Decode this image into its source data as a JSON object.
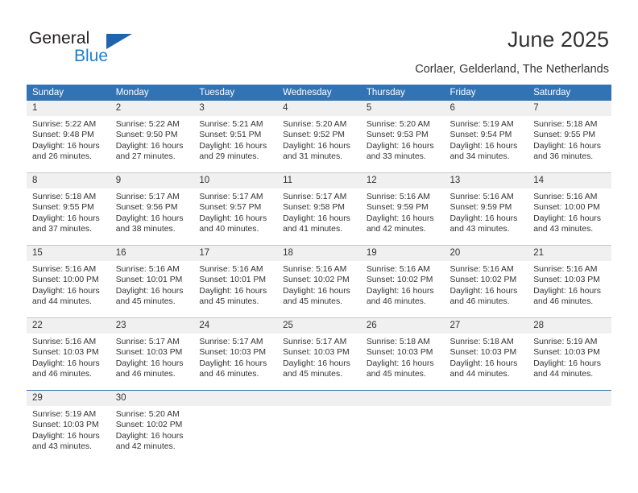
{
  "brand": {
    "name_part1": "General",
    "name_part2": "Blue",
    "triangle_color": "#1f64ad",
    "blue_color": "#1a7fd4"
  },
  "header": {
    "title": "June 2025",
    "subtitle": "Corlaer, Gelderland, The Netherlands"
  },
  "theme": {
    "header_bg": "#3273b5",
    "daynum_bg": "#f0f0f0",
    "text": "#333333",
    "row_divider": "#c8c8c8",
    "accent_divider": "#2f6eb0"
  },
  "calendar": {
    "weekdays": [
      "Sunday",
      "Monday",
      "Tuesday",
      "Wednesday",
      "Thursday",
      "Friday",
      "Saturday"
    ],
    "weeks": [
      [
        {
          "day": "1",
          "sunrise": "Sunrise: 5:22 AM",
          "sunset": "Sunset: 9:48 PM",
          "daylight1": "Daylight: 16 hours",
          "daylight2": "and 26 minutes."
        },
        {
          "day": "2",
          "sunrise": "Sunrise: 5:22 AM",
          "sunset": "Sunset: 9:50 PM",
          "daylight1": "Daylight: 16 hours",
          "daylight2": "and 27 minutes."
        },
        {
          "day": "3",
          "sunrise": "Sunrise: 5:21 AM",
          "sunset": "Sunset: 9:51 PM",
          "daylight1": "Daylight: 16 hours",
          "daylight2": "and 29 minutes."
        },
        {
          "day": "4",
          "sunrise": "Sunrise: 5:20 AM",
          "sunset": "Sunset: 9:52 PM",
          "daylight1": "Daylight: 16 hours",
          "daylight2": "and 31 minutes."
        },
        {
          "day": "5",
          "sunrise": "Sunrise: 5:20 AM",
          "sunset": "Sunset: 9:53 PM",
          "daylight1": "Daylight: 16 hours",
          "daylight2": "and 33 minutes."
        },
        {
          "day": "6",
          "sunrise": "Sunrise: 5:19 AM",
          "sunset": "Sunset: 9:54 PM",
          "daylight1": "Daylight: 16 hours",
          "daylight2": "and 34 minutes."
        },
        {
          "day": "7",
          "sunrise": "Sunrise: 5:18 AM",
          "sunset": "Sunset: 9:55 PM",
          "daylight1": "Daylight: 16 hours",
          "daylight2": "and 36 minutes."
        }
      ],
      [
        {
          "day": "8",
          "sunrise": "Sunrise: 5:18 AM",
          "sunset": "Sunset: 9:55 PM",
          "daylight1": "Daylight: 16 hours",
          "daylight2": "and 37 minutes."
        },
        {
          "day": "9",
          "sunrise": "Sunrise: 5:17 AM",
          "sunset": "Sunset: 9:56 PM",
          "daylight1": "Daylight: 16 hours",
          "daylight2": "and 38 minutes."
        },
        {
          "day": "10",
          "sunrise": "Sunrise: 5:17 AM",
          "sunset": "Sunset: 9:57 PM",
          "daylight1": "Daylight: 16 hours",
          "daylight2": "and 40 minutes."
        },
        {
          "day": "11",
          "sunrise": "Sunrise: 5:17 AM",
          "sunset": "Sunset: 9:58 PM",
          "daylight1": "Daylight: 16 hours",
          "daylight2": "and 41 minutes."
        },
        {
          "day": "12",
          "sunrise": "Sunrise: 5:16 AM",
          "sunset": "Sunset: 9:59 PM",
          "daylight1": "Daylight: 16 hours",
          "daylight2": "and 42 minutes."
        },
        {
          "day": "13",
          "sunrise": "Sunrise: 5:16 AM",
          "sunset": "Sunset: 9:59 PM",
          "daylight1": "Daylight: 16 hours",
          "daylight2": "and 43 minutes."
        },
        {
          "day": "14",
          "sunrise": "Sunrise: 5:16 AM",
          "sunset": "Sunset: 10:00 PM",
          "daylight1": "Daylight: 16 hours",
          "daylight2": "and 43 minutes."
        }
      ],
      [
        {
          "day": "15",
          "sunrise": "Sunrise: 5:16 AM",
          "sunset": "Sunset: 10:00 PM",
          "daylight1": "Daylight: 16 hours",
          "daylight2": "and 44 minutes."
        },
        {
          "day": "16",
          "sunrise": "Sunrise: 5:16 AM",
          "sunset": "Sunset: 10:01 PM",
          "daylight1": "Daylight: 16 hours",
          "daylight2": "and 45 minutes."
        },
        {
          "day": "17",
          "sunrise": "Sunrise: 5:16 AM",
          "sunset": "Sunset: 10:01 PM",
          "daylight1": "Daylight: 16 hours",
          "daylight2": "and 45 minutes."
        },
        {
          "day": "18",
          "sunrise": "Sunrise: 5:16 AM",
          "sunset": "Sunset: 10:02 PM",
          "daylight1": "Daylight: 16 hours",
          "daylight2": "and 45 minutes."
        },
        {
          "day": "19",
          "sunrise": "Sunrise: 5:16 AM",
          "sunset": "Sunset: 10:02 PM",
          "daylight1": "Daylight: 16 hours",
          "daylight2": "and 46 minutes."
        },
        {
          "day": "20",
          "sunrise": "Sunrise: 5:16 AM",
          "sunset": "Sunset: 10:02 PM",
          "daylight1": "Daylight: 16 hours",
          "daylight2": "and 46 minutes."
        },
        {
          "day": "21",
          "sunrise": "Sunrise: 5:16 AM",
          "sunset": "Sunset: 10:03 PM",
          "daylight1": "Daylight: 16 hours",
          "daylight2": "and 46 minutes."
        }
      ],
      [
        {
          "day": "22",
          "sunrise": "Sunrise: 5:16 AM",
          "sunset": "Sunset: 10:03 PM",
          "daylight1": "Daylight: 16 hours",
          "daylight2": "and 46 minutes."
        },
        {
          "day": "23",
          "sunrise": "Sunrise: 5:17 AM",
          "sunset": "Sunset: 10:03 PM",
          "daylight1": "Daylight: 16 hours",
          "daylight2": "and 46 minutes."
        },
        {
          "day": "24",
          "sunrise": "Sunrise: 5:17 AM",
          "sunset": "Sunset: 10:03 PM",
          "daylight1": "Daylight: 16 hours",
          "daylight2": "and 46 minutes."
        },
        {
          "day": "25",
          "sunrise": "Sunrise: 5:17 AM",
          "sunset": "Sunset: 10:03 PM",
          "daylight1": "Daylight: 16 hours",
          "daylight2": "and 45 minutes."
        },
        {
          "day": "26",
          "sunrise": "Sunrise: 5:18 AM",
          "sunset": "Sunset: 10:03 PM",
          "daylight1": "Daylight: 16 hours",
          "daylight2": "and 45 minutes."
        },
        {
          "day": "27",
          "sunrise": "Sunrise: 5:18 AM",
          "sunset": "Sunset: 10:03 PM",
          "daylight1": "Daylight: 16 hours",
          "daylight2": "and 44 minutes."
        },
        {
          "day": "28",
          "sunrise": "Sunrise: 5:19 AM",
          "sunset": "Sunset: 10:03 PM",
          "daylight1": "Daylight: 16 hours",
          "daylight2": "and 44 minutes."
        }
      ],
      [
        {
          "day": "29",
          "sunrise": "Sunrise: 5:19 AM",
          "sunset": "Sunset: 10:03 PM",
          "daylight1": "Daylight: 16 hours",
          "daylight2": "and 43 minutes."
        },
        {
          "day": "30",
          "sunrise": "Sunrise: 5:20 AM",
          "sunset": "Sunset: 10:02 PM",
          "daylight1": "Daylight: 16 hours",
          "daylight2": "and 42 minutes."
        },
        {
          "day": "",
          "sunrise": "",
          "sunset": "",
          "daylight1": "",
          "daylight2": ""
        },
        {
          "day": "",
          "sunrise": "",
          "sunset": "",
          "daylight1": "",
          "daylight2": ""
        },
        {
          "day": "",
          "sunrise": "",
          "sunset": "",
          "daylight1": "",
          "daylight2": ""
        },
        {
          "day": "",
          "sunrise": "",
          "sunset": "",
          "daylight1": "",
          "daylight2": ""
        },
        {
          "day": "",
          "sunrise": "",
          "sunset": "",
          "daylight1": "",
          "daylight2": ""
        }
      ]
    ]
  }
}
